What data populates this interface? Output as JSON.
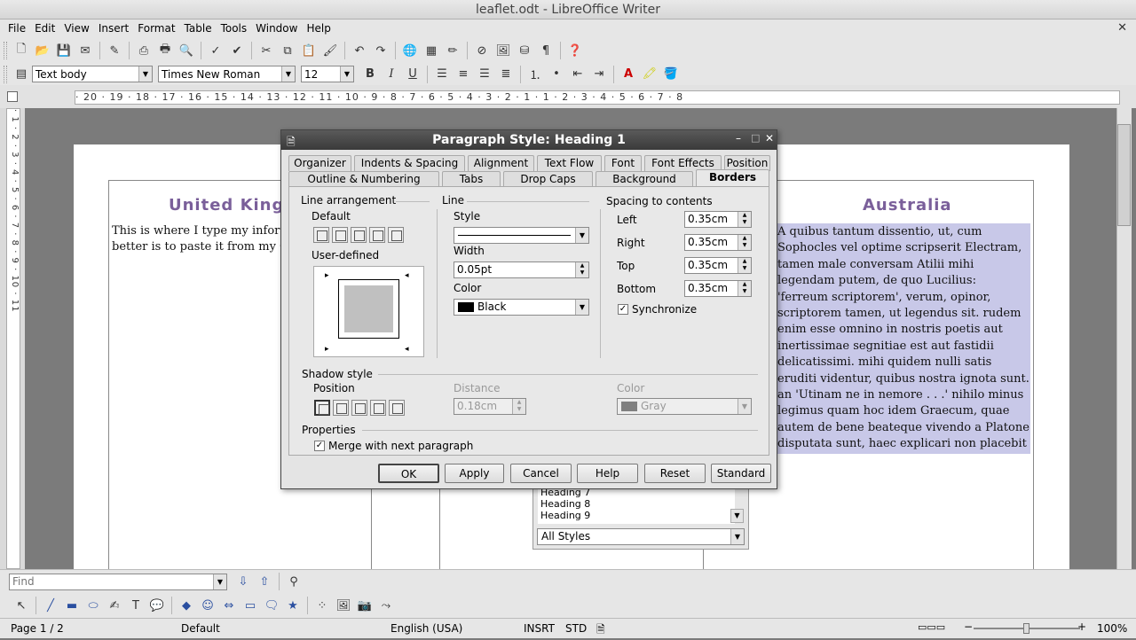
{
  "window": {
    "title": "leaflet.odt - LibreOffice Writer"
  },
  "menubar": {
    "items": [
      "File",
      "Edit",
      "View",
      "Insert",
      "Format",
      "Table",
      "Tools",
      "Window",
      "Help"
    ],
    "close_glyph": "✕"
  },
  "formatting": {
    "paragraph_style": "Text body",
    "font_name": "Times New Roman",
    "font_size": "12"
  },
  "ruler": {
    "horizontal": "· 20 · 19 · 18 · 17 · 16 · 15 · 14 · 13 · 12 · 11 · 10 · 9 · 8 · 7 · 6 · 5 · 4 · 3 · 2 · 1 · 1 · 2 · 3 · 4 · 5 · 6 · 7 · 8",
    "vertical": "· 1 · 2 · 3 · 4 · 5 · 6 · 7 · 8 · 9 · 10 · 11"
  },
  "document": {
    "left_heading": "United Kingo",
    "left_body_line1": "This is where I type my infor",
    "left_body_line2": "better is to paste it from my G",
    "right_heading": "Australia",
    "right_body": "A quibus tantum dissentio, ut, cum Sophocles vel optime scripserit Electram, tamen male conversam Atilii mihi legendam putem, de quo Lucilius: 'ferreum scriptorem', verum, opinor, scriptorem tamen, ut legendus sit. rudem enim esse omnino in nostris poetis aut inertissimae segnitiae est aut fastidii delicatissimi. mihi quidem nulli satis eruditi videntur, quibus nostra ignota sunt. an 'Utinam ne in nemore . . .' nihilo minus legimus quam hoc idem Graecum, quae autem de bene beateque vivendo a Platone disputata sunt, haec explicari non placebit Latine?"
  },
  "styles_panel": {
    "items": [
      "Heading 7",
      "Heading 8",
      "Heading 9"
    ],
    "filter": "All Styles"
  },
  "dialog": {
    "title": "Paragraph Style: Heading 1",
    "tabs_row1": [
      "Organizer",
      "Indents & Spacing",
      "Alignment",
      "Text Flow",
      "Font",
      "Font Effects",
      "Position"
    ],
    "tabs_row2": [
      "Outline & Numbering",
      "Tabs",
      "Drop Caps",
      "Background",
      "Borders"
    ],
    "active_tab": "Borders",
    "line_arrangement": {
      "heading": "Line arrangement",
      "default_label": "Default",
      "user_defined_label": "User-defined"
    },
    "line": {
      "heading": "Line",
      "style_label": "Style",
      "width_label": "Width",
      "width_value": "0.05pt",
      "color_label": "Color",
      "color_value": "Black",
      "color_swatch": "#000000"
    },
    "spacing": {
      "heading": "Spacing to contents",
      "left_label": "Left",
      "left_value": "0.35cm",
      "right_label": "Right",
      "right_value": "0.35cm",
      "top_label": "Top",
      "top_value": "0.35cm",
      "bottom_label": "Bottom",
      "bottom_value": "0.35cm",
      "sync_label": "Synchronize",
      "sync_checked": true
    },
    "shadow": {
      "heading": "Shadow style",
      "position_label": "Position",
      "distance_label": "Distance",
      "distance_value": "0.18cm",
      "color_label": "Color",
      "color_value": "Gray",
      "color_swatch": "#808080"
    },
    "properties": {
      "heading": "Properties",
      "merge_label": "Merge with next paragraph",
      "merge_checked": true
    },
    "buttons": {
      "ok": "OK",
      "apply": "Apply",
      "cancel": "Cancel",
      "help": "Help",
      "reset": "Reset",
      "standard": "Standard"
    }
  },
  "findbar": {
    "placeholder": "Find"
  },
  "status": {
    "page": "Page 1 / 2",
    "style": "Default",
    "language": "English (USA)",
    "insert_mode": "INSRT",
    "selection_mode": "STD",
    "zoom": "100%"
  },
  "colors": {
    "heading": "#7a5f9a",
    "selection": "#c8c8e8",
    "dialog_title": "#3a3a3a"
  }
}
